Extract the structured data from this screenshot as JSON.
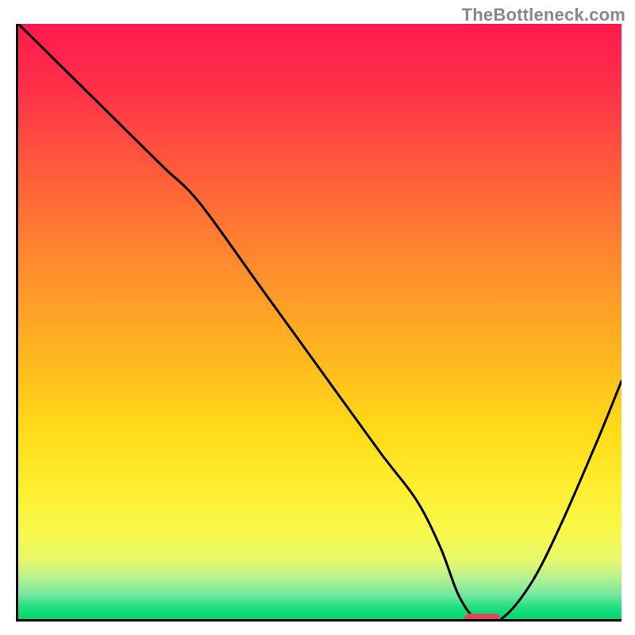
{
  "watermark": "TheBottleneck.com",
  "chart_data": {
    "type": "line",
    "title": "",
    "xlabel": "",
    "ylabel": "",
    "xlim": [
      0,
      100
    ],
    "ylim": [
      0,
      100
    ],
    "x": [
      0,
      8,
      16,
      24,
      30,
      40,
      50,
      60,
      66,
      70,
      73,
      76,
      80,
      85,
      90,
      96,
      100
    ],
    "y": [
      100,
      92,
      84,
      76,
      70,
      56,
      42,
      28,
      20,
      12,
      4,
      0,
      0,
      6,
      16,
      30,
      40
    ],
    "marker": {
      "x": 77,
      "y": 0,
      "width": 6,
      "color": "#d84a5a"
    },
    "background_gradient": {
      "direction": "vertical",
      "stops": [
        {
          "pos": 0,
          "color": "#ff1a4d"
        },
        {
          "pos": 25,
          "color": "#ff5c3a"
        },
        {
          "pos": 55,
          "color": "#ffb420"
        },
        {
          "pos": 78,
          "color": "#ffee30"
        },
        {
          "pos": 93,
          "color": "#b8f090"
        },
        {
          "pos": 100,
          "color": "#00d66b"
        }
      ]
    }
  }
}
